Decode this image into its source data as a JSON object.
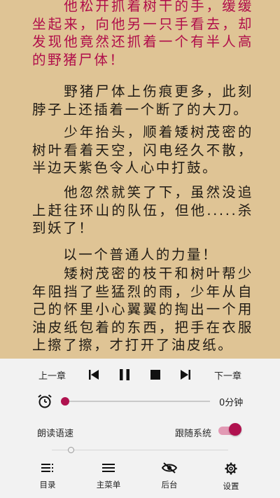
{
  "reader": {
    "paragraphs": [
      {
        "text": "　　他松开抓着树干的手，缓缓坐起来，向他另一只手看去，却发现他竟然还抓着一个有半人高的野猪尸体！",
        "highlighted": true
      },
      {
        "text": "　　野猪尸体上伤痕更多，此刻脖子上还插着一个断了的大刀。",
        "highlighted": false
      },
      {
        "text": "　　少年抬头，顺着矮树茂密的树叶看着天空，闪电经久不散，半边天紫色令人心中打鼓。",
        "highlighted": false
      },
      {
        "text": "　　他忽然就笑了下，虽然没追上赶往环山的队伍，但他.....杀到妖了！",
        "highlighted": false
      },
      {
        "text": "　　以一个普通人的力量！",
        "highlighted": false
      },
      {
        "text": "　　矮树茂密的枝干和树叶帮少年阻挡了些猛烈的雨，少年从自己的怀里小心翼翼的掏出一个用油皮纸包着的东西，把手在衣服上擦了擦，才打开了油皮纸。",
        "highlighted": false
      }
    ]
  },
  "player": {
    "prev_chapter": "上一章",
    "next_chapter": "下一章",
    "timer_value": "0分钟",
    "timer_progress": 0,
    "speed_label": "朗读语速",
    "follow_system_label": "跟随系统",
    "follow_system_on": true,
    "speed_level": 0.1
  },
  "nav": {
    "catalog": "目录",
    "main_menu": "主菜单",
    "background": "后台",
    "settings": "设置"
  },
  "colors": {
    "page_bg": "#dfc495",
    "highlight_text": "#b00d4a",
    "accent": "#b0124f",
    "panel_bg": "#f2f2f2"
  }
}
